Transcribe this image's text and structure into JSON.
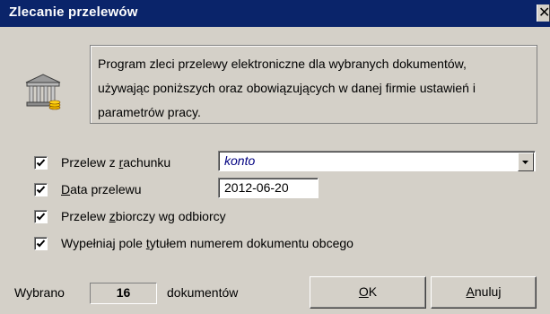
{
  "window": {
    "title": "Zlecanie przelewów",
    "close_glyph": "✕"
  },
  "info": {
    "lines": [
      "Program zleci przelewy elektroniczne dla wybranych dokumentów,",
      "używając poniższych oraz obowiązujących w danej firmie ustawień i",
      "parametrów pracy."
    ]
  },
  "options": {
    "account": {
      "label_pre": "Przelew z ",
      "label_key": "r",
      "label_post": "achunku",
      "checked": true,
      "value": "konto"
    },
    "date": {
      "label_pre": "",
      "label_key": "D",
      "label_post": "ata przelewu",
      "checked": true,
      "value": "2012-06-20"
    },
    "collective": {
      "label_pre": "Przelew ",
      "label_key": "z",
      "label_post": "biorczy wg odbiorcy",
      "checked": true
    },
    "title_fill": {
      "label_pre": "Wypełniaj pole ",
      "label_key": "t",
      "label_post": "ytułem numerem dokumentu obcego",
      "checked": true
    }
  },
  "footer": {
    "selected_label": "Wybrano",
    "count": "16",
    "count_suffix": "dokumentów"
  },
  "buttons": {
    "ok": {
      "key": "O",
      "rest": "K"
    },
    "cancel": {
      "key": "A",
      "rest": "nuluj"
    }
  },
  "icons": {
    "bank": "bank-building-icon",
    "check": "checkmark-icon",
    "dropdown": "chevron-down-icon",
    "close": "close-icon"
  },
  "colors": {
    "title_bar": "#0a246a",
    "window_bg": "#d4d0c8",
    "combo_text": "#000080"
  }
}
